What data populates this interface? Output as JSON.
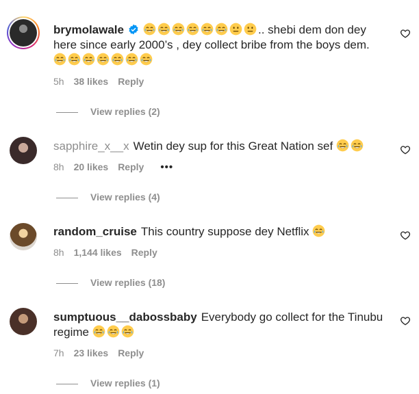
{
  "comments": [
    {
      "username": "brymolawale",
      "verified": true,
      "story_ring": true,
      "text_before": "",
      "lead_emojis": [
        "joy",
        "joy",
        "joy",
        "joy",
        "joy",
        "joy",
        "neutral",
        "neutral"
      ],
      "text": ".. shebi dem don dey here since early 2000’s , dey collect bribe from the boys dem.",
      "trail_emojis": [
        "joy",
        "joy",
        "joy",
        "joy",
        "joy",
        "joy",
        "joy"
      ],
      "time": "5h",
      "likes": "38 likes",
      "reply_label": "Reply",
      "view_replies": "View replies (2)"
    },
    {
      "username": "sapphire_x__x",
      "text": "Wetin dey sup for this Great Nation sef",
      "trail_emojis": [
        "joy",
        "joy"
      ],
      "time": "8h",
      "likes": "20 likes",
      "reply_label": "Reply",
      "more": "•••",
      "view_replies": "View replies (4)"
    },
    {
      "username": "random_cruise",
      "text": "This country suppose dey Netflix",
      "trail_emojis": [
        "joy"
      ],
      "time": "8h",
      "likes": "1,144 likes",
      "reply_label": "Reply",
      "view_replies": "View replies (18)"
    },
    {
      "username": "sumptuous__dabossbaby",
      "text": "Everybody go collect for the Tinubu regime",
      "trail_emojis": [
        "joy",
        "joy",
        "joy"
      ],
      "time": "7h",
      "likes": "23 likes",
      "reply_label": "Reply",
      "view_replies": "View replies (1)"
    }
  ],
  "icons": {
    "like": "heart-outline-icon",
    "verified": "verified-badge-icon",
    "emoji_joy": "tears-of-joy-emoji",
    "emoji_neutral": "neutral-face-emoji"
  },
  "colors": {
    "text": "#262626",
    "muted": "#8e8e8e",
    "verified": "#0095f6",
    "emoji": "#ffcc4d"
  }
}
